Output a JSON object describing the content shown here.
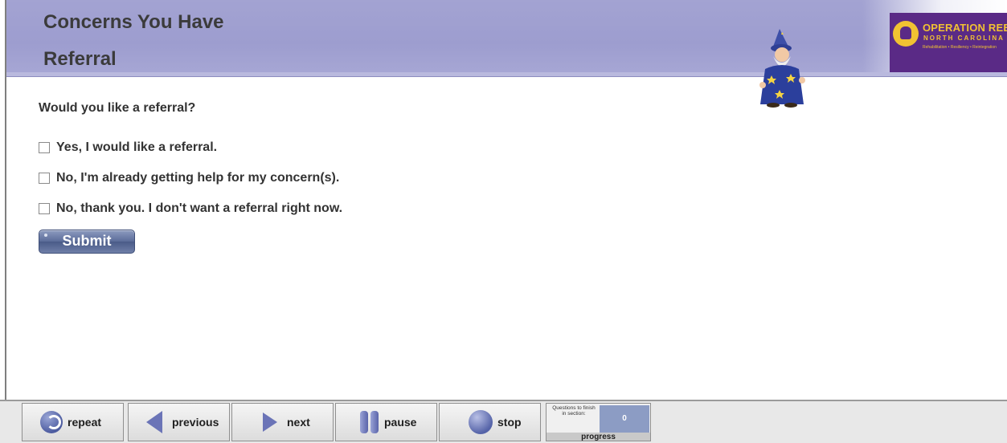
{
  "header": {
    "section_title": "Concerns You Have",
    "page_title": "Referral",
    "logo": {
      "line1": "OPERATION REENTRY",
      "line2": "NORTH CAROLINA",
      "line3": "Rehabilitation • Resiliency • Reintegration"
    }
  },
  "question": {
    "prompt": "Would you like a referral?",
    "options": [
      {
        "label": "Yes, I would like a referral.",
        "checked": false
      },
      {
        "label": "No, I'm already getting help for my concern(s).",
        "checked": false
      },
      {
        "label": "No, thank you. I don't want a referral right now.",
        "checked": false
      }
    ],
    "submit_label": "Submit"
  },
  "toolbar": {
    "repeat": "repeat",
    "previous": "previous",
    "next": "next",
    "pause": "pause",
    "stop": "stop",
    "progress": {
      "questions_label": "Questions to finish in section:",
      "count": "0",
      "label": "progress"
    }
  },
  "colors": {
    "header_bg": "#9d9dcf",
    "logo_bg": "#5a2a86",
    "logo_text": "#f1c232",
    "submit_bg": "#5b6c99",
    "icon_accent": "#6b74b7"
  },
  "icons": [
    "repeat-icon",
    "previous-arrow-icon",
    "next-arrow-icon",
    "pause-icon",
    "stop-icon",
    "wizard-character",
    "operation-reentry-logo"
  ]
}
